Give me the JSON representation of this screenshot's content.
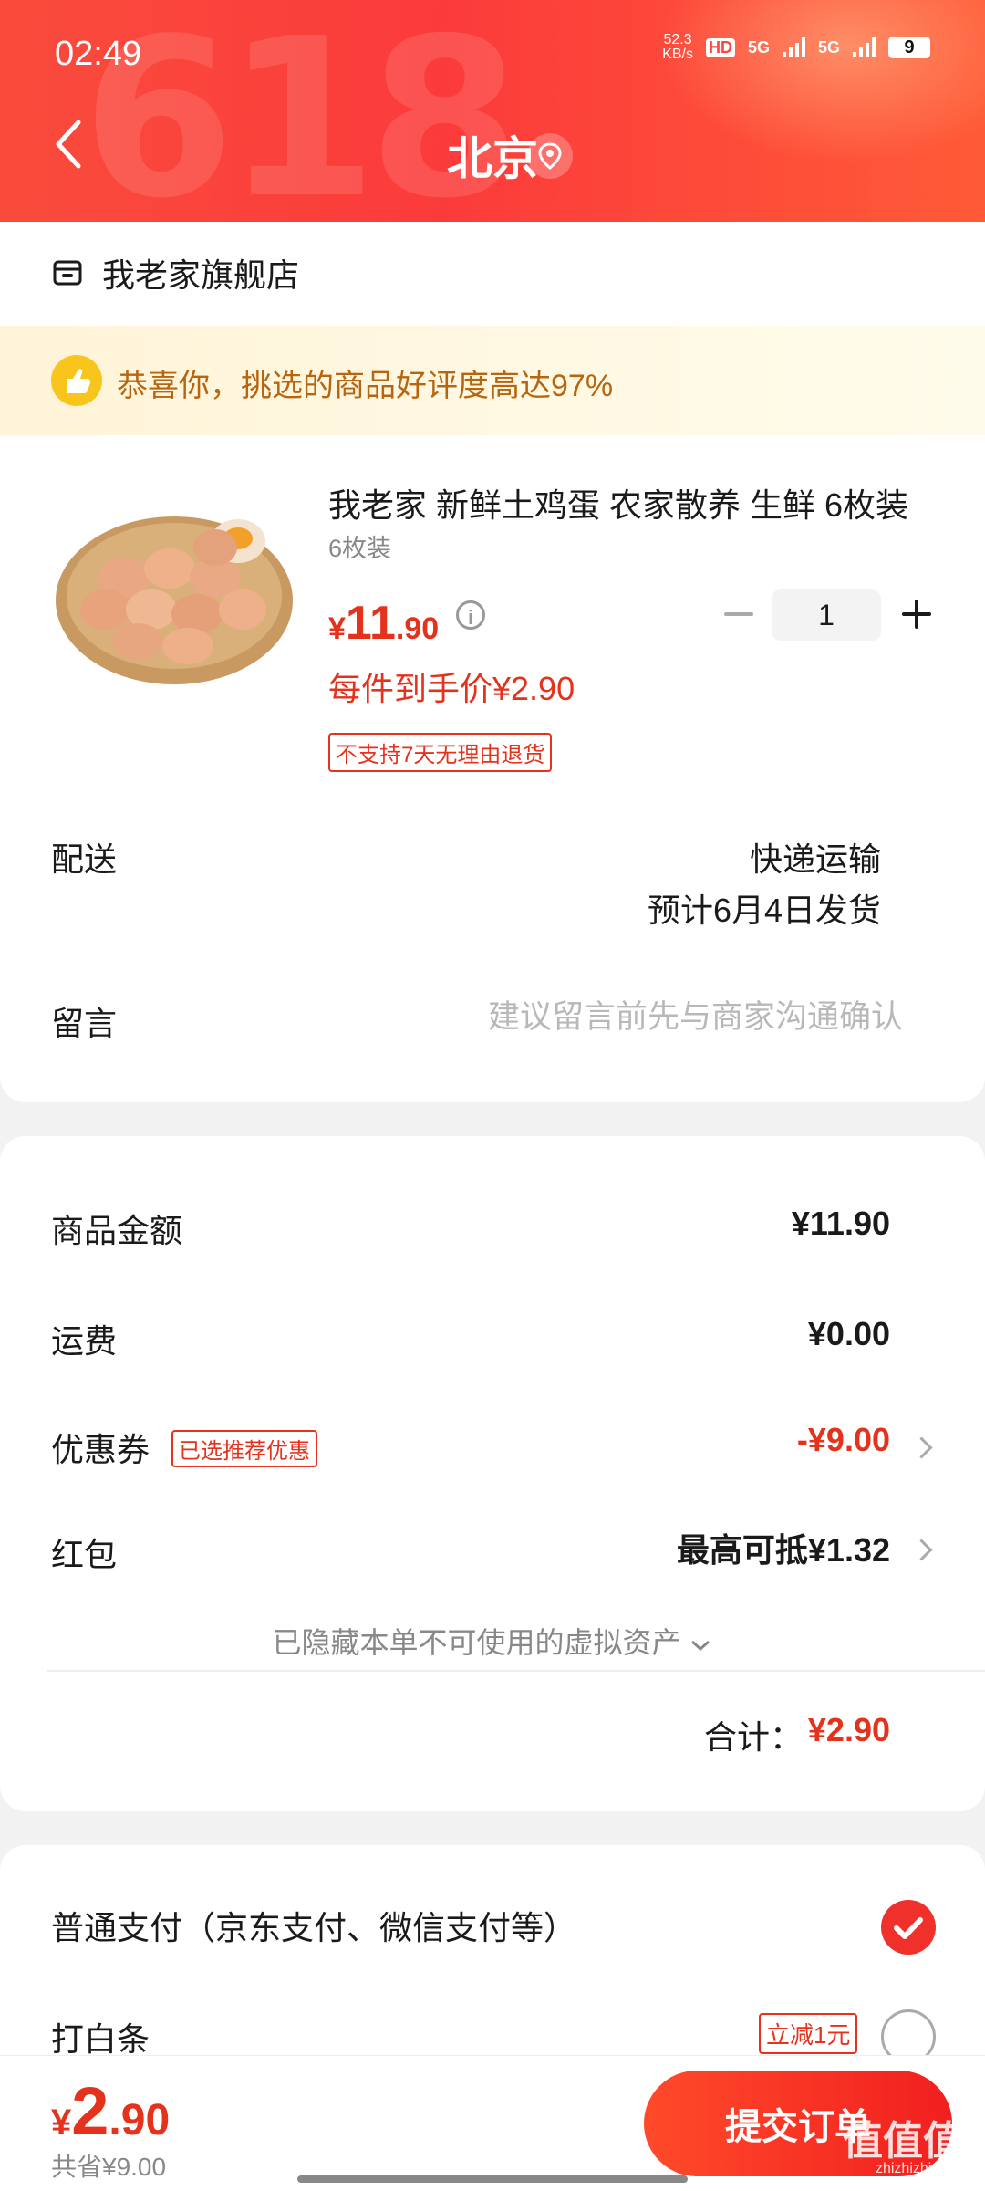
{
  "status_bar": {
    "time": "02:49",
    "net_speed_value": "52.3",
    "net_speed_unit": "KB/s",
    "hd": "HD",
    "sig1": "5G",
    "sig2": "5G",
    "battery": "9"
  },
  "header": {
    "title": "北京",
    "back_icon": "chevron-left-icon",
    "location_icon": "location-pin-icon",
    "colors": {
      "accent": "#f94b3c"
    }
  },
  "store": {
    "name": "我老家旗舰店",
    "icon": "store-icon"
  },
  "tip": {
    "text": "恭喜你，挑选的商品好评度高达97%",
    "icon": "thumbs-up-icon"
  },
  "product": {
    "title": "我老家 新鲜土鸡蛋 农家散养 生鲜 6枚装",
    "spec": "6枚装",
    "price_currency": "¥",
    "price_int": "11",
    "price_dec": ".90",
    "quantity": "1",
    "per_price": "每件到手价¥2.90",
    "return_policy": "不支持7天无理由退货"
  },
  "delivery": {
    "label": "配送",
    "method": "快递运输",
    "date": "预计6月4日发货"
  },
  "message": {
    "label": "留言",
    "placeholder": "建议留言前先与商家沟通确认"
  },
  "summary": {
    "goods_label": "商品金额",
    "goods_value": "¥11.90",
    "shipping_label": "运费",
    "shipping_value": "¥0.00",
    "coupon_label": "优惠券",
    "coupon_tag": "已选推荐优惠",
    "coupon_value": "-¥9.00",
    "redpacket_label": "红包",
    "redpacket_value": "最高可抵¥1.32",
    "hidden_assets": "已隐藏本单不可使用的虚拟资产",
    "total_label": "合计：",
    "total_value": "¥2.90"
  },
  "payment": {
    "normal_label": "普通支付（京东支付、微信支付等）",
    "baitiao_label": "打白条",
    "baitiao_tag": "立减1元"
  },
  "bottom": {
    "price_currency": "¥",
    "price_int": "2",
    "price_dec": ".90",
    "saved": "共省¥9.00",
    "submit": "提交订单"
  },
  "watermark": {
    "text": "值值值",
    "sub": "zhizhizhi.com"
  }
}
